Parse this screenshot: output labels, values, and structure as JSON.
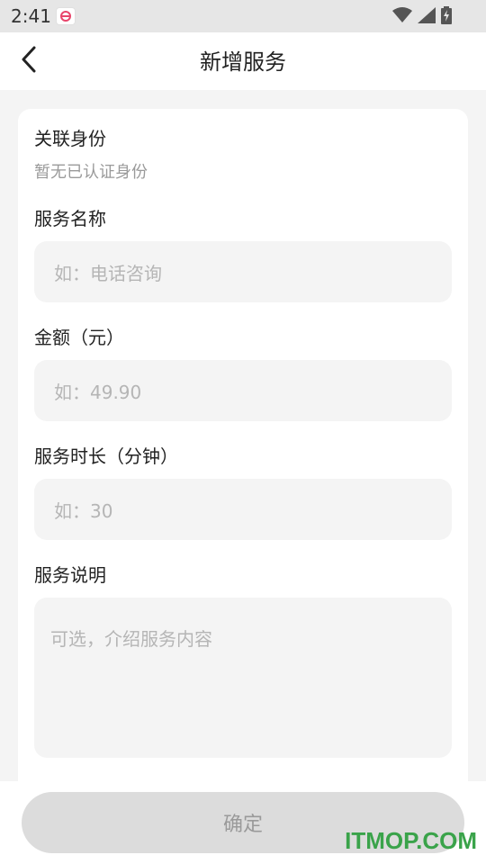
{
  "status_bar": {
    "time": "2:41",
    "icons": [
      "app-notification-icon",
      "wifi-icon",
      "signal-icon",
      "battery-icon"
    ]
  },
  "nav": {
    "title": "新增服务",
    "back_icon": "back-chevron-icon"
  },
  "form": {
    "identity": {
      "label": "关联身份",
      "value": "暂无已认证身份"
    },
    "service_name": {
      "label": "服务名称",
      "value": "",
      "placeholder": "如：电话咨询"
    },
    "amount": {
      "label": "金额（元）",
      "value": "",
      "placeholder": "如：49.90"
    },
    "duration": {
      "label": "服务时长（分钟）",
      "value": "",
      "placeholder": "如：30"
    },
    "description": {
      "label": "服务说明",
      "value": "",
      "placeholder": "可选，介绍服务内容"
    }
  },
  "confirm_button": {
    "label": "确定"
  },
  "watermark": "ITMOP.COM",
  "colors": {
    "page_background": "#f4f4f4",
    "card_background": "#ffffff",
    "input_background": "#f4f4f4",
    "button_disabled": "#dcdcdc",
    "watermark": "#3aa34a",
    "app_icon_accent": "#e8456b"
  }
}
